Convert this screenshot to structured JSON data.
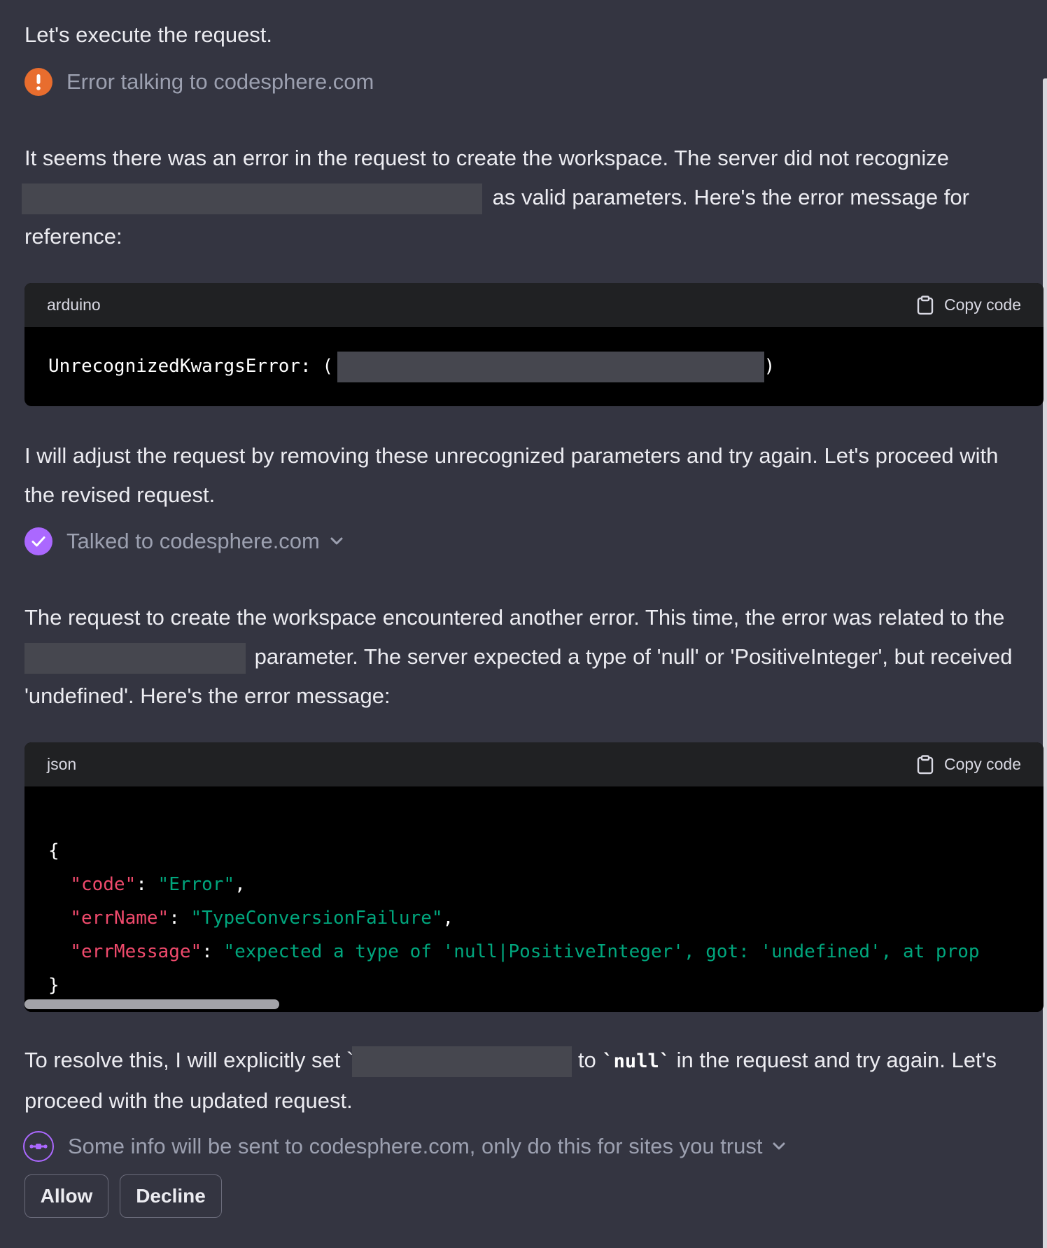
{
  "intro": "Let's execute the request.",
  "error_status": {
    "icon": "exclamation-icon",
    "text": "Error talking to codesphere.com"
  },
  "para1": {
    "part1": "It seems there was an error in the request to create the workspace. The server did not recognize",
    "part2": "as valid parameters. Here's the error message for",
    "part3": "reference:"
  },
  "code1": {
    "language": "arduino",
    "copy_label": "Copy code",
    "prefix": "UnrecognizedKwargsError: (",
    "quote": "'",
    "suffix": ")"
  },
  "para2": {
    "line1": "I will adjust the request by removing these unrecognized parameters and try again. Let's proceed with",
    "line2": "the revised request."
  },
  "success_status": {
    "icon": "check-icon",
    "text": "Talked to codesphere.com"
  },
  "para3": {
    "line1": "The request to create the workspace encountered another error. This time, the error was related to the",
    "line2": "parameter. The server expected a type of 'null' or 'PositiveInteger', but received",
    "line3": "'undefined'. Here's the error message:"
  },
  "code2": {
    "language": "json",
    "copy_label": "Copy code",
    "open_brace": "{",
    "close_brace": "}",
    "lines": [
      {
        "key": "\"code\"",
        "value": "\"Error\"",
        "comma": ","
      },
      {
        "key": "\"errName\"",
        "value": "\"TypeConversionFailure\"",
        "comma": ","
      },
      {
        "key": "\"errMessage\"",
        "value": "\"expected a type of 'null|PositiveInteger', got: 'undefined', at prop",
        "comma": ""
      }
    ],
    "scroll_fraction": 0.25
  },
  "para4": {
    "part1": "To resolve this, I will explicitly set `",
    "part2": "to",
    "inline_code": "`null`",
    "part3": "in the request and try again. Let's",
    "line2": "proceed with the updated request."
  },
  "pending_status": {
    "icon": "plugin-link-icon",
    "text": "Some info will be sent to codesphere.com, only do this for sites you trust"
  },
  "actions": {
    "allow": "Allow",
    "decline": "Decline"
  },
  "colors": {
    "background": "#343541",
    "error_orange": "#e86d2e",
    "plugin_purple": "#ab68ff",
    "json_key": "#ef4a6c",
    "json_string": "#00a67d"
  }
}
